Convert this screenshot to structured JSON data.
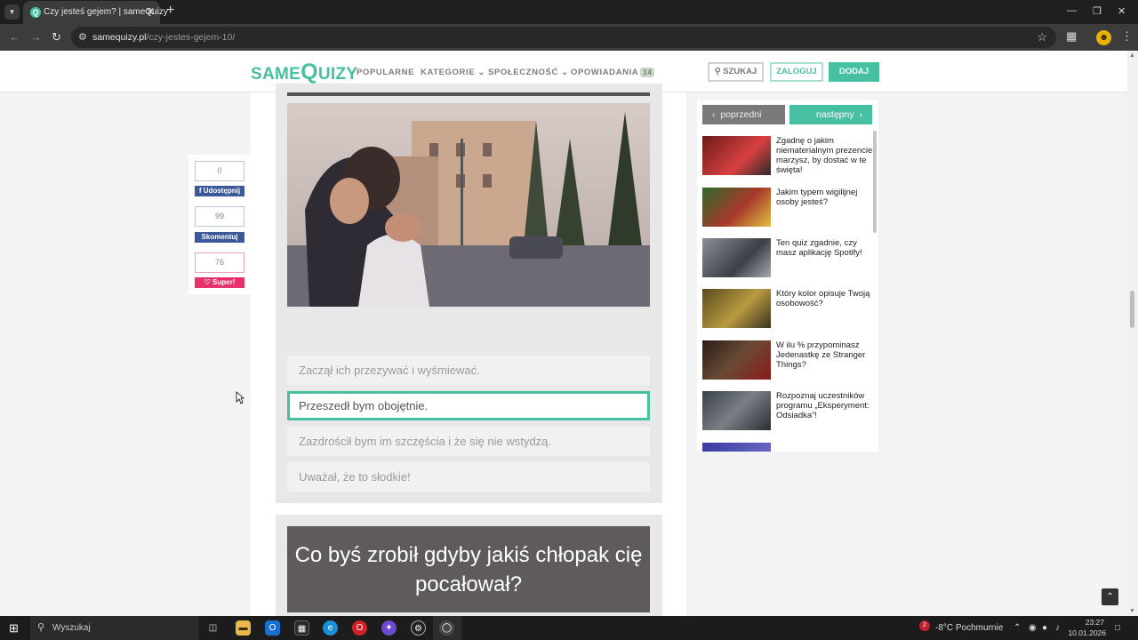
{
  "browser": {
    "tab_title": "Czy jesteś gejem? | sameQuizy",
    "url_host": "samequizy.pl",
    "url_path": "/czy-jestes-gejem-10/"
  },
  "header": {
    "logo_left": "SAME",
    "logo_q": "Q",
    "logo_right": "UIZY",
    "menu": [
      "POPULARNE",
      "KATEGORIE",
      "SPOŁECZNOŚĆ",
      "OPOWIADANIA"
    ],
    "opowiadania_badge": "14",
    "search_label": "SZUKAJ",
    "login_label": "ZALOGUJ",
    "add_label": "DODAJ"
  },
  "share": {
    "share_count": "0",
    "share_label": "Udostępnij",
    "comment_count": "99",
    "comment_label": "Skomentuj",
    "like_count": "76",
    "like_label": "Super!"
  },
  "question": {
    "answers": [
      "Zaczął ich przezywać i wyśmiewać.",
      "Przeszedł bym obojętnie.",
      "Zazdrościł bym im szczęścia i że się nie wstydzą.",
      "Uważał, że to słodkie!"
    ],
    "selected_index": 1,
    "next_title": "Co byś zrobił gdyby jakiś chłopak cię pocałował?"
  },
  "sidebar": {
    "prev_label": "poprzedni",
    "next_label": "następny",
    "items": [
      {
        "title": "Zgadnę o jakim niematerialnym prezencie marzysz, by dostać w te święta!"
      },
      {
        "title": "Jakim typem wigilijnej osoby jesteś?"
      },
      {
        "title": "Ten quiz zgadnie, czy masz aplikację Spotify!"
      },
      {
        "title": "Który kolor opisuje Twoją osobowość?"
      },
      {
        "title": "W ilu % przypominasz Jedenastkę ze Stranger Things?"
      },
      {
        "title": "Rozpoznaj uczestników programu „Eksperyment: Odsiadka”!"
      }
    ]
  },
  "taskbar": {
    "search_placeholder": "Wyszukaj",
    "weather": "-8°C  Pochmurnie",
    "weather_badge": "2",
    "time": "23:27",
    "date": "10.01.2026"
  }
}
